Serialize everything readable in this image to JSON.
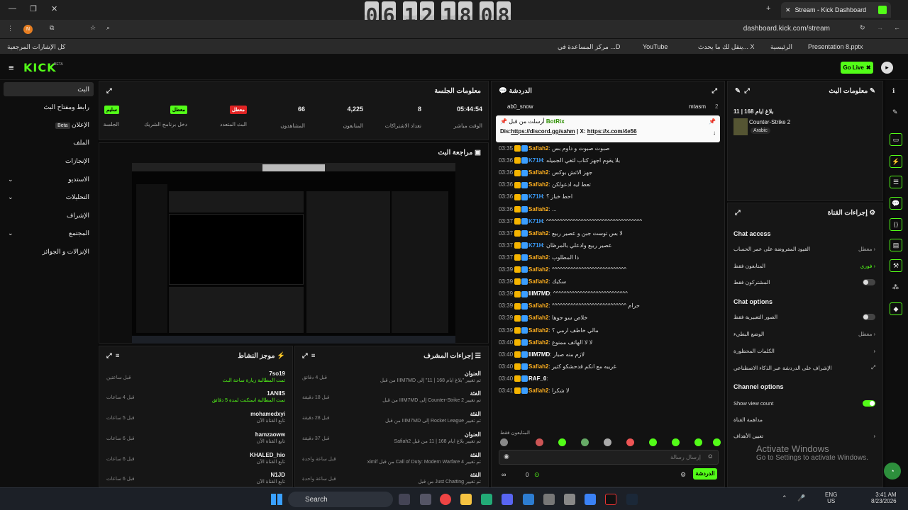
{
  "browser": {
    "tab_title": "Stream - Kick Dashboard",
    "url": "dashboard.kick.com/stream",
    "clock_digits": [
      "0",
      "6",
      "1",
      "2",
      "1",
      "8",
      "0",
      "8"
    ],
    "bookmarks": {
      "all": "كل الإشارات المرجعية",
      "b1": "مركز المساعدة في ...D",
      "b2": "YouTube",
      "b3": "ينقل لك ما يحدث... X",
      "b4": "الرئيسية",
      "b5": "Presentation 8.pptx"
    }
  },
  "kick": {
    "logo": "KICK",
    "beta": "BETA",
    "go_live": "Go Live"
  },
  "nav": [
    {
      "label": "البث"
    },
    {
      "label": "رابط ومفتاح البث"
    },
    {
      "label": "الإعلان",
      "badge": "Beta"
    },
    {
      "label": "الملف"
    },
    {
      "label": "الإنجازات"
    },
    {
      "label": "الاستديو"
    },
    {
      "label": "التحليلات"
    },
    {
      "label": "الإشراف"
    },
    {
      "label": "المجتمع"
    },
    {
      "label": "الإنزالات و الجوائز"
    }
  ],
  "session": {
    "title": "معلومات الجلسة",
    "stats": [
      {
        "value": "05:44:54",
        "label": "الوقت مباشر"
      },
      {
        "value": "8",
        "label": "تعداد الاشتراكات"
      },
      {
        "value": "4,225",
        "label": "المتابعون"
      },
      {
        "value": "66",
        "label": "المشاهدون"
      },
      {
        "tag": "معطل",
        "label": "البث المتعدد",
        "color": "#e02424"
      },
      {
        "tag": "معطل",
        "label": "دخل برنامج الشريك",
        "color": "#53fc18"
      },
      {
        "tag": "سليم",
        "label": "الجلسة",
        "color": "#53fc18"
      }
    ]
  },
  "preview": {
    "title": "مراجعة البث"
  },
  "activity": {
    "title": "موجز النشاط",
    "items": [
      {
        "name": "7so19",
        "sub": "تمت المطالبة زيارة ساحة البث",
        "time": "قبل ساعتين"
      },
      {
        "name": "1ANIIS",
        "sub": "تمت المطالبة استكنت لمدة 5 دقائق",
        "time": "قبل 4 ساعات"
      },
      {
        "name": "mohamedxyi",
        "sub": "تابع القناة الآن",
        "time": "قبل 5 ساعات"
      },
      {
        "name": "hamzaoww",
        "sub": "تابع القناة الآن",
        "time": "قبل 6 ساعات"
      },
      {
        "name": "KHALED_hio",
        "sub": "تابع القناة الآن",
        "time": "قبل 6 ساعات"
      },
      {
        "name": "N1JD",
        "sub": "تابع القناة الآن",
        "time": "قبل 6 ساعات"
      }
    ]
  },
  "modactions": {
    "title": "إجراءات المشرف",
    "items": [
      {
        "head": "العنوان",
        "body": "تم تغيير \"بلاغ ايام 168 | 11\" إلى IIIM7MD من قبل",
        "time": "قبل 4 دقائق"
      },
      {
        "head": "الفئة",
        "body": "تم تغيير Counter-Strike 2 إلى IIIM7MD من قبل",
        "time": "قبل 18 دقيقة"
      },
      {
        "head": "الفئة",
        "body": "تم تغيير Rocket League إلى IIIM7MD من قبل",
        "time": "قبل 28 دقيقة"
      },
      {
        "head": "العنوان",
        "body": "تم تغيير بلاغ ايام 168 | 11 من قبل Safiah2",
        "time": "قبل 37 دقيقة"
      },
      {
        "head": "الفئة",
        "body": "تم تغيير Call of Duty: Modern Warfare 4 من قبل ximif",
        "time": "قبل ساعة واحدة"
      },
      {
        "head": "الفئة",
        "body": "تم تغيير Just Chatting من قبل",
        "time": "قبل ساعة واحدة"
      }
    ]
  },
  "chat": {
    "title": "الدردشة",
    "top_user": "ab0_snow",
    "top_user2": "mtasm",
    "top_count": "2",
    "pinned": {
      "user": "BotRix",
      "by": "أرسلت من قبل",
      "text_dis": "Dis:",
      "link1": "https://discord.gg/sahm",
      "sep": "| X:",
      "link2": "https://x.com/4e56"
    },
    "messages": [
      {
        "ts": "03:35",
        "user": "Safiah2",
        "color": "#ffb020",
        "text": "صبوت صبوت و داوم بس"
      },
      {
        "ts": "03:36",
        "user": "K71H",
        "color": "#3b9eff",
        "text": "بلا يقوم اجهز كتاب لثغي الجميله"
      },
      {
        "ts": "03:36",
        "user": "Safiah2",
        "color": "#ffb020",
        "text": "جهز الاتش بوكس"
      },
      {
        "ts": "03:36",
        "user": "Safiah2",
        "color": "#ffb020",
        "text": "تعط ليه ادعولكن"
      },
      {
        "ts": "03:36",
        "user": "K71H",
        "color": "#3b9eff",
        "text": "احط خباز ؟"
      },
      {
        "ts": "03:36",
        "user": "Safiah2",
        "color": "#ffb020",
        "text": "..."
      },
      {
        "ts": "03:37",
        "user": "K71H",
        "color": "#3b9eff",
        "text": "^^^^^^^^^^^^^^^^^^^^^^^^^^^^^^^^^^^^"
      },
      {
        "ts": "03:37",
        "user": "Safiah2",
        "color": "#ffb020",
        "text": "لا بس توست جبن و عصير ربيع"
      },
      {
        "ts": "03:37",
        "user": "K71H",
        "color": "#3b9eff",
        "text": "عصير ربيع وادعلي بالمرظان"
      },
      {
        "ts": "03:37",
        "user": "Safiah2",
        "color": "#ffb020",
        "text": "ذا المطلوب"
      },
      {
        "ts": "03:39",
        "user": "Safiah2",
        "color": "#ffb020",
        "text": "^^^^^^^^^^^^^^^^^^^^^^^^^^^^"
      },
      {
        "ts": "03:39",
        "user": "Safiah2",
        "color": "#ffb020",
        "text": "سكيك"
      },
      {
        "ts": "03:39",
        "user": "IIIM7MD",
        "color": "#ffffff",
        "text": "^^^^^^^^^^^^^^^^^^^^^^^^^^^^"
      },
      {
        "ts": "03:39",
        "user": "Safiah2",
        "color": "#ffb020",
        "text": "^^^^^^^^^^^^^^^^^^^^^^^^^^^^ حرام"
      },
      {
        "ts": "03:39",
        "user": "Safiah2",
        "color": "#ffb020",
        "text": "خلاص سو جوها"
      },
      {
        "ts": "03:39",
        "user": "Safiah2",
        "color": "#ffb020",
        "text": "مالي خاطف ارمي ؟"
      },
      {
        "ts": "03:40",
        "user": "Safiah2",
        "color": "#ffb020",
        "text": "لا لا الهاتف ممنوع"
      },
      {
        "ts": "03:40",
        "user": "IIIM7MD",
        "color": "#ffffff",
        "text": "لازم منه صبار"
      },
      {
        "ts": "03:40",
        "user": "Safiah2",
        "color": "#ffb020",
        "text": "غريبه مع انكم قدحشكو كثير"
      },
      {
        "ts": "03:40",
        "user": "RAF_0",
        "color": "#ffffff",
        "text": ""
      },
      {
        "ts": "03:41",
        "user": "Safiah2",
        "color": "#ffb020",
        "text": "لا شكرا"
      }
    ],
    "input_placeholder": "إرسال رسالة",
    "footer_count": "0",
    "send_label": "الدردشة",
    "top_supporters": "المتابعون فقط"
  },
  "streaminfo": {
    "title": "معلومات البث",
    "stream_title": "بلاغ ايام 168 | 11",
    "category": "Counter-Strike 2",
    "language": "Arabic"
  },
  "channelactions": {
    "title": "إجراءات القناة",
    "chat_access": "Chat access",
    "rows1": [
      {
        "label": "القيود المفروضة على عمر الحساب",
        "value": "معطل"
      },
      {
        "label": "المتابعون فقط",
        "value": "فوري"
      },
      {
        "label": "المشتركون فقط",
        "value": ""
      }
    ],
    "chat_options": "Chat options",
    "rows2": [
      {
        "label": "الصور التعبيرية فقط",
        "value": ""
      },
      {
        "label": "الوضع البطيء",
        "value": "معطل"
      },
      {
        "label": "الكلمات المحظورة",
        "value": ""
      },
      {
        "label": "الإشراف على الدردشة عبر الذكاء الاصطناعي",
        "value": ""
      }
    ],
    "channel_options": "Channel options",
    "rows3": [
      {
        "label": "Show view count",
        "value": ""
      },
      {
        "label": "مداهمة القناة",
        "value": ""
      },
      {
        "label": "تعيين الأهداف",
        "value": ""
      }
    ]
  },
  "watermark": {
    "line1": "Activate Windows",
    "line2": "Go to Settings to activate Windows."
  },
  "taskbar": {
    "search": "Search",
    "lang1": "ENG",
    "lang2": "US",
    "time": "3:41 AM",
    "date": "8/23/2026"
  }
}
